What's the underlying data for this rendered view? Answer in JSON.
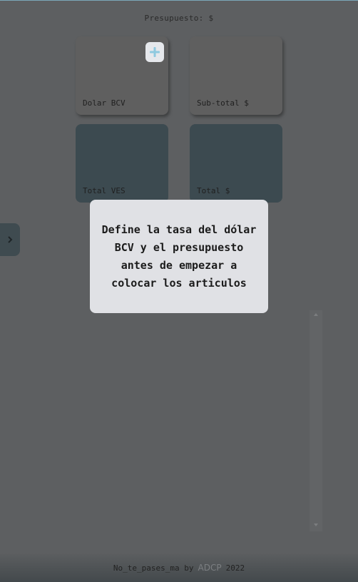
{
  "header": {
    "budget_label": "Presupuesto: $"
  },
  "cards": [
    {
      "label": "Dolar BCV"
    },
    {
      "label": "Sub-total $"
    },
    {
      "label": "Total VES"
    },
    {
      "label": "Total $"
    }
  ],
  "add_button": {
    "symbol": "+"
  },
  "modal": {
    "message": "Define la tasa del dólar BCV y el presupuesto antes de empezar a colocar los articulos"
  },
  "footer": {
    "author": "No_te_pases_ma",
    "by": "by",
    "brand": "ADCP",
    "year": "2022"
  }
}
